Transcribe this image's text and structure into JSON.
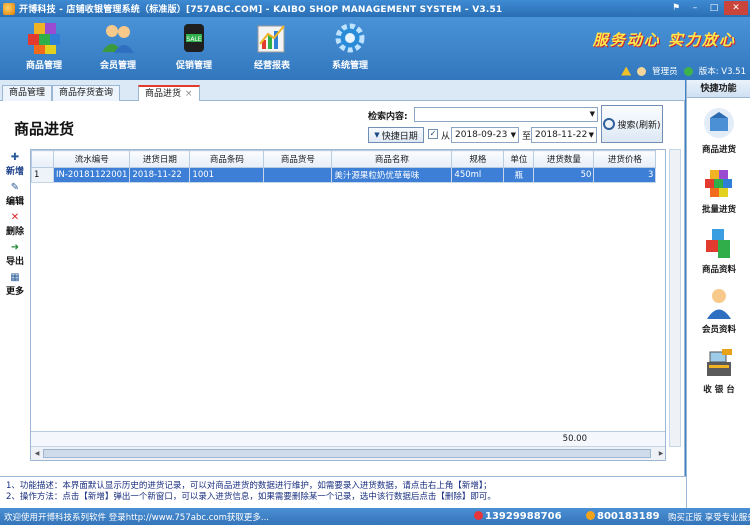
{
  "window": {
    "title": "开博科技 - 店铺收银管理系统（标准版）[757ABC.COM] - KAIBO SHOP MANAGEMENT SYSTEM - V3.51",
    "controls": [
      "⚑",
      "–",
      "□",
      "✕"
    ]
  },
  "toolbar": {
    "items": [
      {
        "label": "商品管理",
        "icon": "cubes-icon"
      },
      {
        "label": "会员管理",
        "icon": "members-icon"
      },
      {
        "label": "促销管理",
        "icon": "sale-icon"
      },
      {
        "label": "经营报表",
        "icon": "report-icon"
      },
      {
        "label": "系统管理",
        "icon": "gear-icon"
      }
    ],
    "slogan": "服务动心 实力放心",
    "user": "管理员",
    "version": "版本: V3.51"
  },
  "tabs": [
    {
      "label": "商品管理",
      "active": false
    },
    {
      "label": "商品存货查询",
      "active": false
    },
    {
      "label": "商品进货",
      "active": true,
      "close": "×"
    }
  ],
  "page": {
    "title": "商品进货",
    "search_label": "检索内容:",
    "search_value": "",
    "quick_date_label": "快捷日期",
    "date_checked": "✓",
    "from_label": "从",
    "date_from": "2018-09-23",
    "to_label": "至",
    "date_to": "2018-11-22",
    "search_button": "搜索(刷新)"
  },
  "actions": [
    {
      "label": "新增",
      "icon": "plus-icon"
    },
    {
      "label": "编辑",
      "icon": "edit-icon"
    },
    {
      "label": "删除",
      "icon": "delete-icon"
    },
    {
      "label": "导出",
      "icon": "export-icon"
    },
    {
      "label": "更多",
      "icon": "more-icon"
    }
  ],
  "table": {
    "columns": [
      "流水编号",
      "进货日期",
      "商品条码",
      "商品货号",
      "商品名称",
      "规格",
      "单位",
      "进货数量",
      "进货价格"
    ],
    "rows": [
      {
        "row_num": "1",
        "cells": [
          "IN-20181122001",
          "2018-11-22",
          "1001",
          "",
          "美汁源果粒奶优草莓味",
          "450ml",
          "瓶",
          "50",
          "3"
        ]
      }
    ],
    "total_quantity": "50.00"
  },
  "notes": [
    "1、功能描述：本界面默认显示历史的进货记录，可以对商品进货的数据进行维护，如需要录入进货数据，请点击右上角【新增】；",
    "2、操作方法：点击【新增】弹出一个新窗口，可以录入进货信息，如果需要删除某一个记录，选中该行数据后点击【删除】即可。"
  ],
  "status": {
    "left": "欢迎使用开博科技系列软件  登录http://www.757abc.com获取更多...",
    "phone": "13929988706",
    "qq": "800183189",
    "buy": "购买正版  享受专业服务"
  },
  "right_panel": {
    "header": "快捷功能",
    "items": [
      {
        "label": "商品进货",
        "icon": "purchase-icon"
      },
      {
        "label": "批量进货",
        "icon": "batch-purchase-icon"
      },
      {
        "label": "商品资料",
        "icon": "product-info-icon"
      },
      {
        "label": "会员资料",
        "icon": "member-info-icon"
      },
      {
        "label": "收 银 台",
        "icon": "cashier-icon"
      }
    ]
  },
  "colors": {
    "title_bar": "#2a6fb5",
    "selected_row": "#3d7fd6",
    "active_tab_accent": "#e23a2f",
    "slogan": "#ffe94a"
  }
}
